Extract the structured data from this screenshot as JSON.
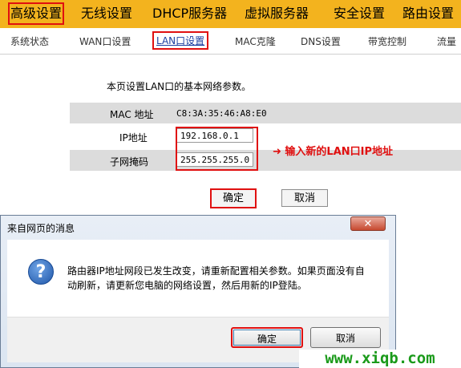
{
  "topnav": [
    "高级设置",
    "无线设置",
    "DHCP服务器",
    "虚拟服务器",
    "安全设置",
    "路由设置"
  ],
  "subnav": [
    "系统状态",
    "WAN口设置",
    "LAN口设置",
    "MAC克隆",
    "DNS设置",
    "带宽控制",
    "流量"
  ],
  "lan": {
    "intro": "本页设置LAN口的基本网络参数。",
    "mac_label": "MAC 地址",
    "mac_value": "C8:3A:35:46:A8:E0",
    "ip_label": "IP地址",
    "ip_value": "192.168.0.1",
    "mask_label": "子网掩码",
    "mask_value": "255.255.255.0",
    "annotation": "输入新的LAN口IP地址",
    "ok_label": "确定",
    "cancel_label": "取消"
  },
  "dialog": {
    "title": "来自网页的消息",
    "close_glyph": "✕",
    "icon_glyph": "?",
    "message": "路由器IP地址网段已发生改变，请重新配置相关参数。如果页面没有自动刷新，请更新您电脑的网络设置，然后用新的IP登陆。",
    "ok_label": "确定",
    "cancel_label": "取消"
  },
  "watermark": "www.xiqb.com",
  "colors": {
    "nav_bg": "#f3b31e",
    "highlight": "#e01010",
    "watermark": "#1a9a1a"
  }
}
